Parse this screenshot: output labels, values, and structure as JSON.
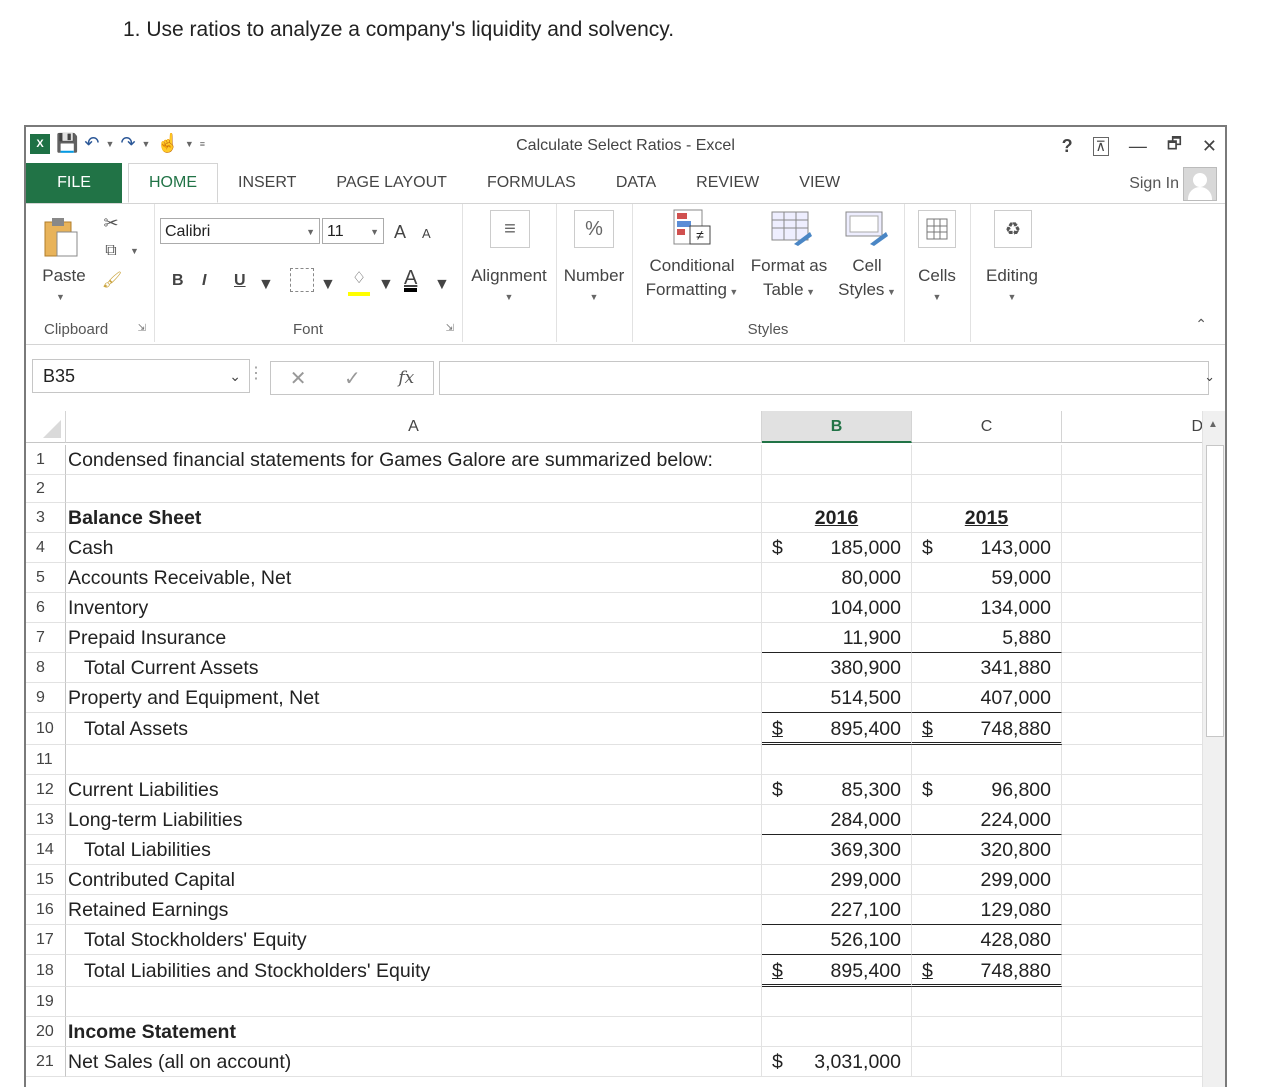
{
  "question": "1. Use ratios to analyze a company's liquidity and solvency.",
  "window": {
    "title": "Calculate Select Ratios - Excel",
    "controls": {
      "help": "?",
      "ribbon_display": "⊼",
      "minimize": "—",
      "restore": "🗗",
      "close": "✕"
    },
    "sign_in": "Sign In"
  },
  "tabs": [
    {
      "label": "FILE"
    },
    {
      "label": "HOME"
    },
    {
      "label": "INSERT"
    },
    {
      "label": "PAGE LAYOUT"
    },
    {
      "label": "FORMULAS"
    },
    {
      "label": "DATA"
    },
    {
      "label": "REVIEW"
    },
    {
      "label": "VIEW"
    }
  ],
  "ribbon": {
    "clipboard": {
      "paste": "Paste",
      "group": "Clipboard"
    },
    "font": {
      "name": "Calibri",
      "size": "11",
      "bold": "B",
      "italic": "I",
      "underline": "U",
      "group": "Font",
      "grow": "A",
      "shrink": "A",
      "font_color_label": "A"
    },
    "alignment": {
      "label": "Alignment"
    },
    "number": {
      "label": "Number",
      "icon": "%"
    },
    "styles": {
      "conditional": "Conditional",
      "conditional2": "Formatting",
      "format_as": "Format as",
      "format_as2": "Table",
      "cell": "Cell",
      "cell2": "Styles",
      "group": "Styles"
    },
    "cells": {
      "label": "Cells"
    },
    "editing": {
      "label": "Editing"
    }
  },
  "formula_bar": {
    "name_box": "B35",
    "cancel": "✕",
    "enter": "✓",
    "fx": "fx",
    "value": ""
  },
  "columns": [
    "A",
    "B",
    "C",
    "D"
  ],
  "selected_column": "B",
  "rows": [
    {
      "n": "1",
      "a": "Condensed financial statements for Games Galore are summarized below:",
      "b": "",
      "c": ""
    },
    {
      "n": "2",
      "a": "",
      "b": "",
      "c": ""
    },
    {
      "n": "3",
      "a": "Balance Sheet",
      "b": "2016",
      "c": "2015"
    },
    {
      "n": "4",
      "a": "Cash",
      "b_dollar": "$",
      "b": "185,000",
      "c_dollar": "$",
      "c": "143,000"
    },
    {
      "n": "5",
      "a": "Accounts Receivable, Net",
      "b": "80,000",
      "c": "59,000"
    },
    {
      "n": "6",
      "a": "Inventory",
      "b": "104,000",
      "c": "134,000"
    },
    {
      "n": "7",
      "a": "Prepaid Insurance",
      "b": "11,900",
      "c": "5,880"
    },
    {
      "n": "8",
      "a": "Total Current Assets",
      "b": "380,900",
      "c": "341,880"
    },
    {
      "n": "9",
      "a": "Property and Equipment, Net",
      "b": "514,500",
      "c": "407,000"
    },
    {
      "n": "10",
      "a": "Total Assets",
      "b_dollar": "$",
      "b": "895,400",
      "c_dollar": "$",
      "c": "748,880"
    },
    {
      "n": "11",
      "a": "",
      "b": "",
      "c": ""
    },
    {
      "n": "12",
      "a": "Current Liabilities",
      "b_dollar": "$",
      "b": "85,300",
      "c_dollar": "$",
      "c": "96,800"
    },
    {
      "n": "13",
      "a": "Long-term Liabilities",
      "b": "284,000",
      "c": "224,000"
    },
    {
      "n": "14",
      "a": "Total Liabilities",
      "b": "369,300",
      "c": "320,800"
    },
    {
      "n": "15",
      "a": "Contributed Capital",
      "b": "299,000",
      "c": "299,000"
    },
    {
      "n": "16",
      "a": "Retained Earnings",
      "b": "227,100",
      "c": "129,080"
    },
    {
      "n": "17",
      "a": "Total Stockholders' Equity",
      "b": "526,100",
      "c": "428,080"
    },
    {
      "n": "18",
      "a": "Total Liabilities and Stockholders' Equity",
      "b_dollar": "$",
      "b": "895,400",
      "c_dollar": "$",
      "c": "748,880"
    },
    {
      "n": "19",
      "a": "",
      "b": "",
      "c": ""
    },
    {
      "n": "20",
      "a": "Income Statement",
      "b": "",
      "c": ""
    },
    {
      "n": "21",
      "a": "Net Sales (all on account)",
      "b_dollar": "$",
      "b": "3,031,000",
      "c": ""
    }
  ]
}
